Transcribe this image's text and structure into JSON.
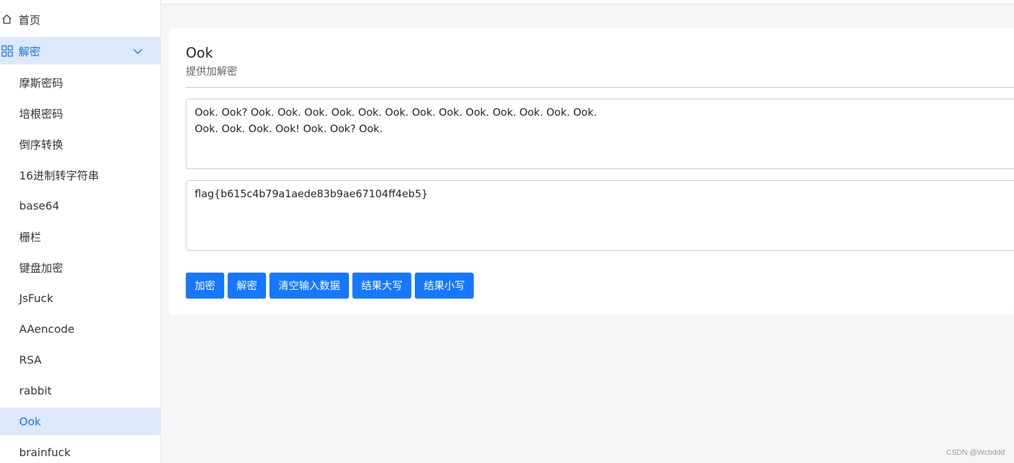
{
  "sidebar": {
    "home": {
      "label": "首页",
      "icon": "home-icon"
    },
    "decrypt_group": {
      "label": "解密",
      "icon": "grid-icon",
      "expanded": true
    },
    "items": [
      {
        "label": "摩斯密码"
      },
      {
        "label": "培根密码"
      },
      {
        "label": "倒序转换"
      },
      {
        "label": "16进制转字符串"
      },
      {
        "label": "base64"
      },
      {
        "label": "栅栏"
      },
      {
        "label": "键盘加密"
      },
      {
        "label": "JsFuck"
      },
      {
        "label": "AAencode"
      },
      {
        "label": "RSA"
      },
      {
        "label": "rabbit"
      },
      {
        "label": "Ook",
        "active": true
      },
      {
        "label": "brainfuck"
      }
    ]
  },
  "main": {
    "title": "Ook",
    "subtitle": "提供加解密",
    "input_text": "Ook. Ook? Ook. Ook. Ook. Ook. Ook. Ook. Ook. Ook. Ook. Ook. Ook. Ook. Ook.\nOok. Ook. Ook. Ook! Ook. Ook? Ook.",
    "output_text": "flag{b615c4b79a1aede83b9ae67104ff4eb5}",
    "buttons": {
      "encrypt": "加密",
      "decrypt": "解密",
      "clear": "清空输入数据",
      "upper": "结果大写",
      "lower": "结果小写"
    }
  },
  "watermark": "CSDN @Wcbddd",
  "colors": {
    "accent": "#1677ff",
    "active_bg": "#dde9fb",
    "active_text": "#1673e6"
  }
}
